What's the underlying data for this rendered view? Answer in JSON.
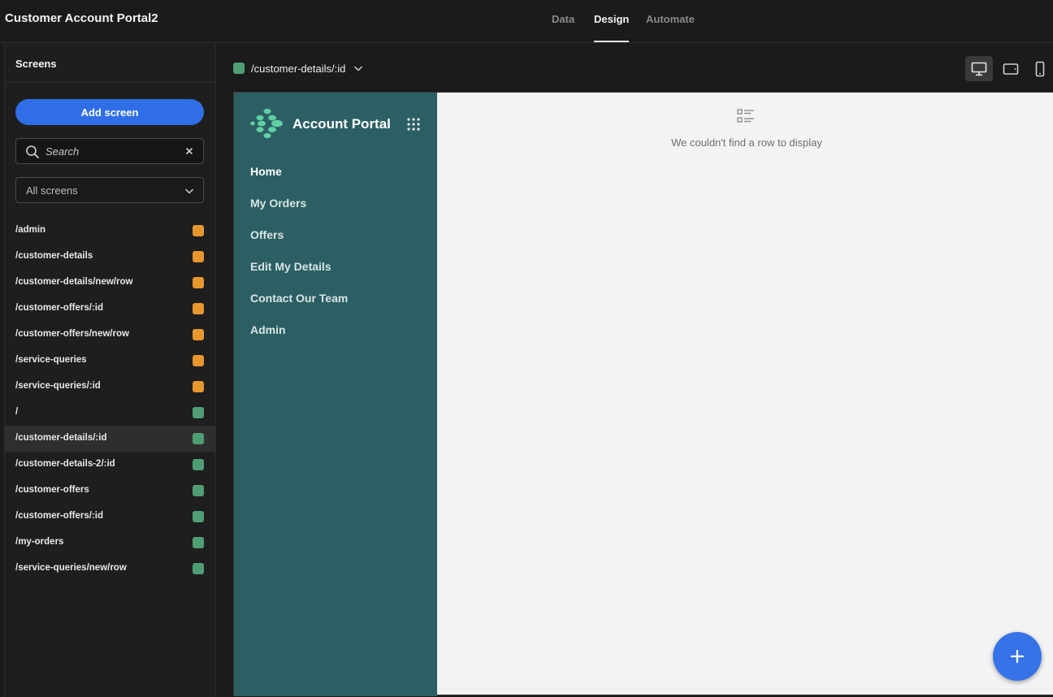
{
  "app": {
    "title": "Customer Account Portal2"
  },
  "top_tabs": [
    {
      "label": "Data",
      "active": false
    },
    {
      "label": "Design",
      "active": true
    },
    {
      "label": "Automate",
      "active": false
    }
  ],
  "sidebar": {
    "title": "Screens",
    "add_screen_label": "Add screen",
    "search": {
      "placeholder": "Search",
      "value": ""
    },
    "filter": {
      "selected": "All screens"
    },
    "screens": [
      {
        "path": "/admin",
        "color": "#e8972f"
      },
      {
        "path": "/customer-details",
        "color": "#e8972f"
      },
      {
        "path": "/customer-details/new/row",
        "color": "#e8972f"
      },
      {
        "path": "/customer-offers/:id",
        "color": "#e8972f"
      },
      {
        "path": "/customer-offers/new/row",
        "color": "#e8972f"
      },
      {
        "path": "/service-queries",
        "color": "#e8972f"
      },
      {
        "path": "/service-queries/:id",
        "color": "#e8972f"
      },
      {
        "path": "/",
        "color": "#4f9e73"
      },
      {
        "path": "/customer-details/:id",
        "color": "#4f9e73",
        "selected": true
      },
      {
        "path": "/customer-details-2/:id",
        "color": "#4f9e73"
      },
      {
        "path": "/customer-offers",
        "color": "#4f9e73"
      },
      {
        "path": "/customer-offers/:id",
        "color": "#4f9e73"
      },
      {
        "path": "/my-orders",
        "color": "#4f9e73"
      },
      {
        "path": "/service-queries/new/row",
        "color": "#4f9e73"
      }
    ]
  },
  "route_bar": {
    "route": "/customer-details/:id",
    "color": "#4f9e73"
  },
  "device_selector": {
    "active": "desktop",
    "options": [
      "desktop-icon",
      "tablet-icon",
      "mobile-icon"
    ]
  },
  "preview": {
    "brand_name": "Account Portal",
    "nav_links": [
      {
        "label": "Home",
        "current": true
      },
      {
        "label": "My Orders"
      },
      {
        "label": "Offers"
      },
      {
        "label": "Edit My Details"
      },
      {
        "label": "Contact Our Team"
      },
      {
        "label": "Admin"
      }
    ],
    "empty_message": "We couldn't find a row to display"
  },
  "colors": {
    "accent": "#2f6ee6",
    "nav_background": "#2c5f63",
    "status_orange": "#e8972f",
    "status_green": "#4f9e73"
  }
}
